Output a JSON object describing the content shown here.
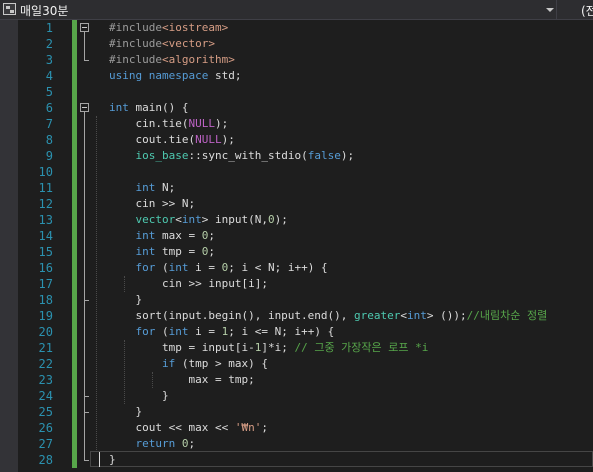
{
  "navbar": {
    "project_label": "매일30분",
    "scope_label": "(전"
  },
  "editor": {
    "lines": [
      {
        "n": "1",
        "t": [
          {
            "c": "pp",
            "s": "#include"
          },
          {
            "c": "inc",
            "s": "<iostream>"
          }
        ]
      },
      {
        "n": "2",
        "t": [
          {
            "c": "pp",
            "s": "#include"
          },
          {
            "c": "inc",
            "s": "<vector>"
          }
        ]
      },
      {
        "n": "3",
        "t": [
          {
            "c": "pp",
            "s": "#include"
          },
          {
            "c": "inc",
            "s": "<algorithm>"
          }
        ]
      },
      {
        "n": "4",
        "t": [
          {
            "c": "kw",
            "s": "using"
          },
          {
            "c": "",
            "s": " "
          },
          {
            "c": "kw",
            "s": "namespace"
          },
          {
            "c": "",
            "s": " std;"
          }
        ]
      },
      {
        "n": "5",
        "t": []
      },
      {
        "n": "6",
        "t": [
          {
            "c": "kw",
            "s": "int"
          },
          {
            "c": "",
            "s": " main() {"
          }
        ]
      },
      {
        "n": "7",
        "t": [
          {
            "c": "",
            "s": "    cin.tie("
          },
          {
            "c": "mac",
            "s": "NULL"
          },
          {
            "c": "",
            "s": ");"
          }
        ]
      },
      {
        "n": "8",
        "t": [
          {
            "c": "",
            "s": "    cout.tie("
          },
          {
            "c": "mac",
            "s": "NULL"
          },
          {
            "c": "",
            "s": ");"
          }
        ]
      },
      {
        "n": "9",
        "t": [
          {
            "c": "",
            "s": "    "
          },
          {
            "c": "typ",
            "s": "ios_base"
          },
          {
            "c": "",
            "s": "::sync_with_stdio("
          },
          {
            "c": "kw",
            "s": "false"
          },
          {
            "c": "",
            "s": ");"
          }
        ]
      },
      {
        "n": "10",
        "t": []
      },
      {
        "n": "11",
        "t": [
          {
            "c": "",
            "s": "    "
          },
          {
            "c": "kw",
            "s": "int"
          },
          {
            "c": "",
            "s": " N;"
          }
        ]
      },
      {
        "n": "12",
        "t": [
          {
            "c": "",
            "s": "    cin >> N;"
          }
        ]
      },
      {
        "n": "13",
        "t": [
          {
            "c": "",
            "s": "    "
          },
          {
            "c": "typ",
            "s": "vector"
          },
          {
            "c": "",
            "s": "<"
          },
          {
            "c": "kw",
            "s": "int"
          },
          {
            "c": "",
            "s": "> input(N,"
          },
          {
            "c": "num",
            "s": "0"
          },
          {
            "c": "",
            "s": ");"
          }
        ]
      },
      {
        "n": "14",
        "t": [
          {
            "c": "",
            "s": "    "
          },
          {
            "c": "kw",
            "s": "int"
          },
          {
            "c": "",
            "s": " max = "
          },
          {
            "c": "num",
            "s": "0"
          },
          {
            "c": "",
            "s": ";"
          }
        ]
      },
      {
        "n": "15",
        "t": [
          {
            "c": "",
            "s": "    "
          },
          {
            "c": "kw",
            "s": "int"
          },
          {
            "c": "",
            "s": " tmp = "
          },
          {
            "c": "num",
            "s": "0"
          },
          {
            "c": "",
            "s": ";"
          }
        ]
      },
      {
        "n": "16",
        "t": [
          {
            "c": "",
            "s": "    "
          },
          {
            "c": "kw",
            "s": "for"
          },
          {
            "c": "",
            "s": " ("
          },
          {
            "c": "kw",
            "s": "int"
          },
          {
            "c": "",
            "s": " i = "
          },
          {
            "c": "num",
            "s": "0"
          },
          {
            "c": "",
            "s": "; i < N; i++) {"
          }
        ]
      },
      {
        "n": "17",
        "t": [
          {
            "c": "",
            "s": "        cin >> input[i];"
          }
        ]
      },
      {
        "n": "18",
        "t": [
          {
            "c": "",
            "s": "    }"
          }
        ]
      },
      {
        "n": "19",
        "t": [
          {
            "c": "",
            "s": "    sort(input.begin(), input.end(), "
          },
          {
            "c": "typ",
            "s": "greater"
          },
          {
            "c": "",
            "s": "<"
          },
          {
            "c": "kw",
            "s": "int"
          },
          {
            "c": "",
            "s": "> ());"
          },
          {
            "c": "cm",
            "s": "//내림차순 정렬"
          }
        ]
      },
      {
        "n": "20",
        "t": [
          {
            "c": "",
            "s": "    "
          },
          {
            "c": "kw",
            "s": "for"
          },
          {
            "c": "",
            "s": " ("
          },
          {
            "c": "kw",
            "s": "int"
          },
          {
            "c": "",
            "s": " i = "
          },
          {
            "c": "num",
            "s": "1"
          },
          {
            "c": "",
            "s": "; i <= N; i++) {"
          }
        ]
      },
      {
        "n": "21",
        "t": [
          {
            "c": "",
            "s": "        tmp = input[i-"
          },
          {
            "c": "num",
            "s": "1"
          },
          {
            "c": "",
            "s": "]*i; "
          },
          {
            "c": "cm",
            "s": "// 그중 가장작은 로프 *i"
          }
        ]
      },
      {
        "n": "22",
        "t": [
          {
            "c": "",
            "s": "        "
          },
          {
            "c": "kw",
            "s": "if"
          },
          {
            "c": "",
            "s": " (tmp > max) {"
          }
        ]
      },
      {
        "n": "23",
        "t": [
          {
            "c": "",
            "s": "            max = tmp;"
          }
        ]
      },
      {
        "n": "24",
        "t": [
          {
            "c": "",
            "s": "        }"
          }
        ]
      },
      {
        "n": "25",
        "t": [
          {
            "c": "",
            "s": "    }"
          }
        ]
      },
      {
        "n": "26",
        "t": [
          {
            "c": "",
            "s": "    cout << max << "
          },
          {
            "c": "str",
            "s": "'₩n'"
          },
          {
            "c": "",
            "s": ";"
          }
        ]
      },
      {
        "n": "27",
        "t": [
          {
            "c": "",
            "s": "    "
          },
          {
            "c": "kw",
            "s": "return"
          },
          {
            "c": "",
            "s": " "
          },
          {
            "c": "num",
            "s": "0"
          },
          {
            "c": "",
            "s": ";"
          }
        ]
      },
      {
        "n": "28",
        "t": [
          {
            "c": "",
            "s": "}"
          }
        ]
      }
    ]
  },
  "colors": {
    "background": "#1e1e1e",
    "line_number": "#2b91af",
    "keyword": "#569cd6",
    "preprocessor": "#9b9b9b",
    "string": "#d69d85",
    "number": "#b5cea8",
    "macro": "#bd63c5",
    "type": "#4ec9b0",
    "comment": "#57a64a",
    "change_bar": "#57a64a"
  },
  "icons": {
    "project": "project-icon",
    "dropdown": "chevron-down-icon",
    "fold": "collapse-icon"
  }
}
